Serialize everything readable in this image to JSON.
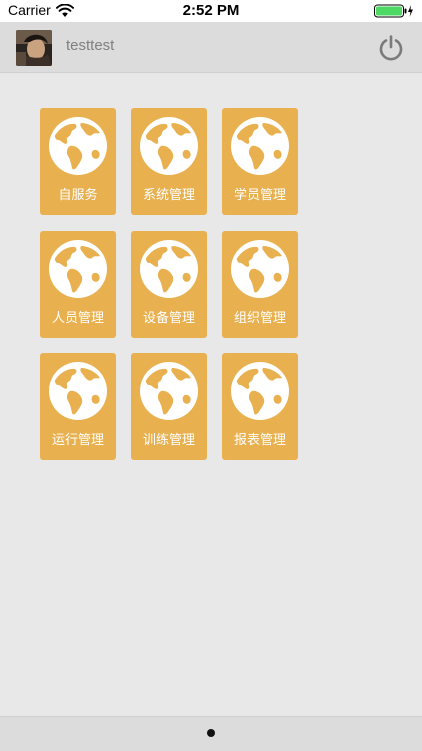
{
  "status_bar": {
    "carrier": "Carrier",
    "time": "2:52 PM",
    "wifi_icon": "wifi-icon",
    "battery_icon": "battery-charging-icon",
    "battery_color": "#4cd964"
  },
  "header": {
    "username": "testtest",
    "avatar": "avatar-photo",
    "power_icon": "power-icon",
    "background": "#dcdcdc"
  },
  "menu": {
    "tile_color": "#e8b04e",
    "icon": "globe-icon",
    "items": [
      {
        "label": "自服务"
      },
      {
        "label": "系统管理"
      },
      {
        "label": "学员管理"
      },
      {
        "label": "人员管理"
      },
      {
        "label": "设备管理"
      },
      {
        "label": "组织管理"
      },
      {
        "label": "运行管理"
      },
      {
        "label": "训练管理"
      },
      {
        "label": "报表管理"
      }
    ]
  },
  "pager": {
    "page_count": 1,
    "current_page": 1
  }
}
